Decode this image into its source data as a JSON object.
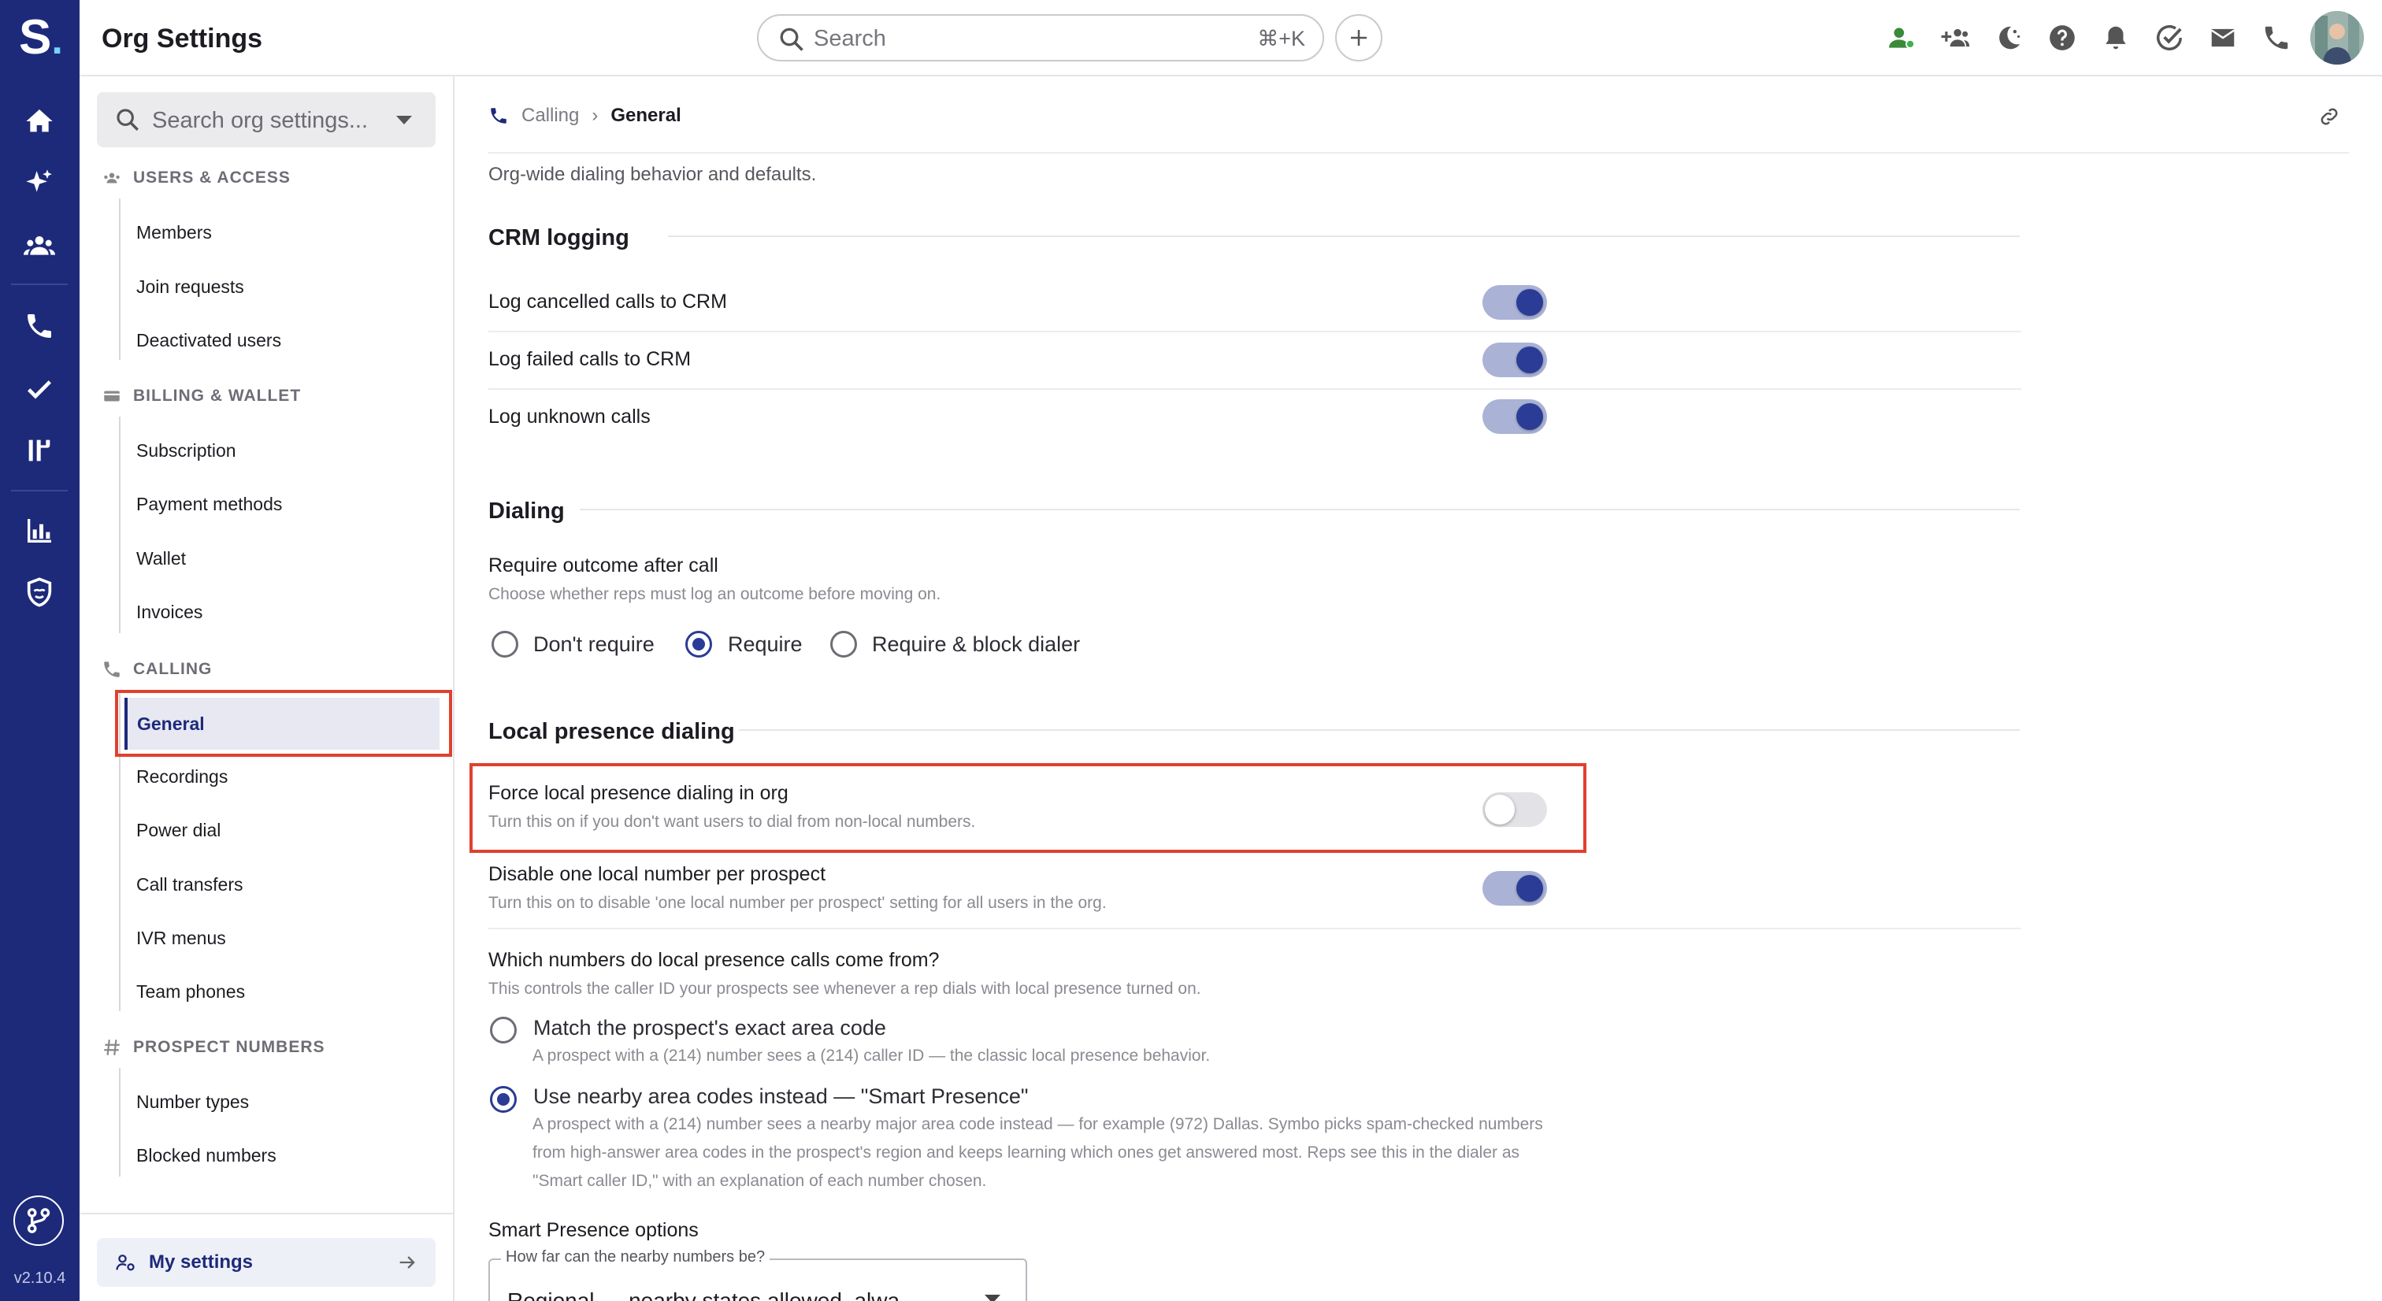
{
  "app": {
    "logo_letter": "S",
    "logo_dot": ".",
    "version": "v2.10.4"
  },
  "topbar": {
    "title": "Org Settings",
    "search_placeholder": "Search",
    "search_shortcut": "⌘+K",
    "icons": [
      "add-icon",
      "presence-icon",
      "add-team-icon",
      "do-not-disturb-icon",
      "help-icon",
      "notifications-icon",
      "tasks-icon",
      "mail-icon",
      "phone-icon",
      "avatar"
    ]
  },
  "rail": {
    "icons": [
      "home-icon",
      "sparkle-icon",
      "team-icon",
      "phone-icon",
      "check-icon",
      "sequences-icon",
      "analytics-icon",
      "shield-icon",
      "integrations-icon"
    ]
  },
  "sidebar": {
    "search_placeholder": "Search org settings...",
    "sections": [
      {
        "title": "USERS & ACCESS",
        "items": [
          "Members",
          "Join requests",
          "Deactivated users"
        ]
      },
      {
        "title": "BILLING & WALLET",
        "items": [
          "Subscription",
          "Payment methods",
          "Wallet",
          "Invoices"
        ]
      },
      {
        "title": "CALLING",
        "items": [
          "General",
          "Recordings",
          "Power dial",
          "Call transfers",
          "IVR menus",
          "Team phones"
        ]
      },
      {
        "title": "PROSPECT NUMBERS",
        "items": [
          "Number types",
          "Blocked numbers"
        ]
      }
    ],
    "active_item": "General",
    "my_settings": "My settings"
  },
  "breadcrumb": {
    "parent": "Calling",
    "current": "General"
  },
  "description": "Org-wide dialing behavior and defaults.",
  "crm_logging": {
    "title": "CRM logging",
    "rows": [
      {
        "label": "Log cancelled calls to CRM",
        "enabled": true
      },
      {
        "label": "Log failed calls to CRM",
        "enabled": true
      },
      {
        "label": "Log unknown calls",
        "enabled": true
      }
    ]
  },
  "dialing": {
    "title": "Dialing",
    "outcome_label": "Require outcome after call",
    "outcome_sub": "Choose whether reps must log an outcome before moving on.",
    "options": [
      "Don't require",
      "Require",
      "Require & block dialer"
    ],
    "selected": "Require"
  },
  "local_presence": {
    "title": "Local presence dialing",
    "force": {
      "label": "Force local presence dialing in org",
      "sub": "Turn this on if you don't want users to dial from non-local numbers.",
      "enabled": false
    },
    "disable_one": {
      "label": "Disable one local number per prospect",
      "sub": "Turn this on to disable 'one local number per prospect' setting for all users in the org.",
      "enabled": true
    },
    "source_label": "Which numbers do local presence calls come from?",
    "source_sub": "This controls the caller ID your prospects see whenever a rep dials with local presence turned on.",
    "source_options": [
      {
        "label": "Match the prospect's exact area code",
        "sub": "A prospect with a (214) number sees a (214) caller ID — the classic local presence behavior.",
        "selected": false
      },
      {
        "label": "Use nearby area codes instead — \"Smart Presence\"",
        "sub": "A prospect with a (214) number sees a nearby major area code instead — for example (972) Dallas. Symbo picks spam-checked numbers from high-answer area codes in the prospect's region and keeps learning which ones get answered most. Reps see this in the dialer as \"Smart caller ID,\" with an explanation of each number chosen.",
        "selected": true
      }
    ],
    "smart_title": "Smart Presence options",
    "distance_label": "How far can the nearby numbers be?",
    "distance_value": "Regional — nearby states allowed, alwa..."
  },
  "colors": {
    "rail": "#1d2a7a",
    "accent": "#2a3c95",
    "toggle_track": "#aab2d6",
    "highlight": "#e0412f"
  }
}
